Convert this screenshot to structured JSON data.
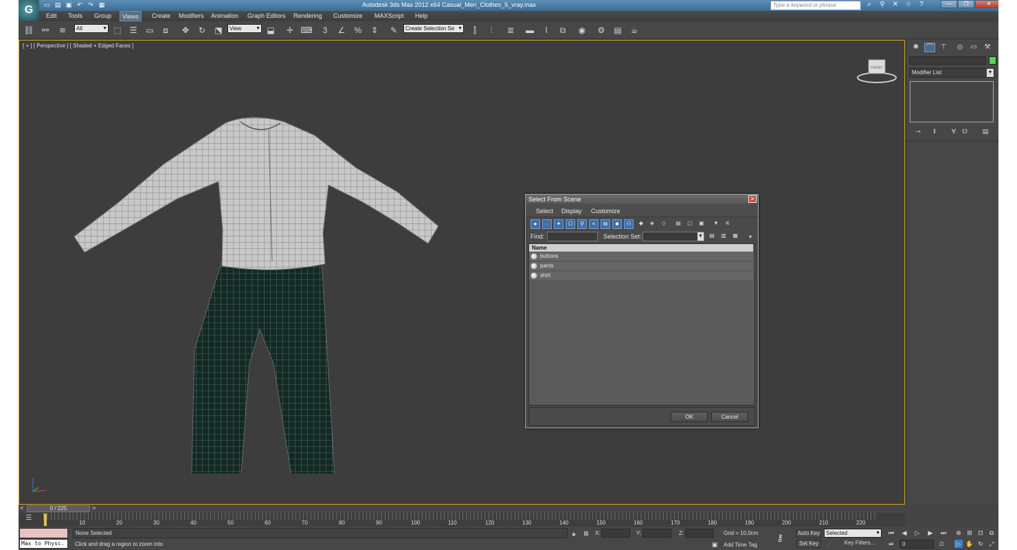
{
  "window": {
    "title": "Autodesk 3ds Max  2012 x64      Casual_Men_Clothes_5_vray.max",
    "search_placeholder": "Type a keyword or phrase"
  },
  "menu": [
    "Edit",
    "Tools",
    "Group",
    "Views",
    "Create",
    "Modifiers",
    "Animation",
    "Graph Editors",
    "Rendering",
    "Customize",
    "MAXScript",
    "Help"
  ],
  "active_menu": "Views",
  "toolbar": {
    "filter_value": "All",
    "refcoord_value": "View",
    "named_sel_value": "Create Selection Se",
    "snap_label": "3"
  },
  "viewport": {
    "label": "[ + ] [ Perspective ] [ Shaded + Edged Faces ]",
    "viewcube_label": "FRONT",
    "mesh_objects": [
      {
        "name": "shirt",
        "color": "#c8c8c8"
      },
      {
        "name": "pants",
        "color": "#132a24"
      }
    ]
  },
  "dialog": {
    "title": "Select From Scene",
    "menu": [
      "Select",
      "Display",
      "Customize"
    ],
    "find_label": "Find:",
    "selection_set_label": "Selection Set:",
    "column_header": "Name",
    "items": [
      "buttons",
      "pants",
      "shirt"
    ],
    "ok_label": "OK",
    "cancel_label": "Cancel"
  },
  "command_panel": {
    "modifier_list_label": "Modifier List",
    "object_color": "#5cd35c"
  },
  "timeline": {
    "frame_label": "0 / 225",
    "left_arrow": "<",
    "right_arrow": ">",
    "ticks": [
      "10",
      "20",
      "30",
      "40",
      "50",
      "60",
      "70",
      "80",
      "90",
      "100",
      "110",
      "120",
      "130",
      "140",
      "150",
      "160",
      "170",
      "180",
      "190",
      "200",
      "210",
      "220"
    ]
  },
  "status": {
    "script_field": "Max to Physc.",
    "selection": "None Selected",
    "prompt": "Click and drag a region to zoom into",
    "x_label": "X:",
    "y_label": "Y:",
    "z_label": "Z:",
    "grid": "Grid = 10,0cm",
    "add_time_tag": "Add Time Tag",
    "auto_key": "Auto Key",
    "set_key": "Set Key",
    "selected_value": "Selected",
    "key_filters": "Key Filters...",
    "frame_value": "0"
  }
}
